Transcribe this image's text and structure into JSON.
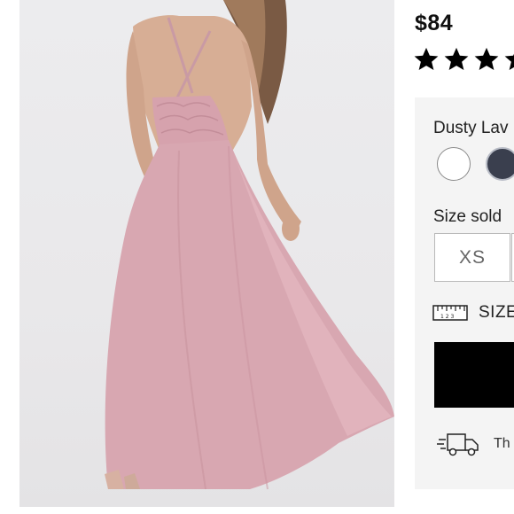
{
  "product": {
    "price": "$84",
    "rating_stars": 5,
    "color_label": "Dusty Lav",
    "swatches": [
      {
        "name": "white",
        "color": "#ffffff"
      },
      {
        "name": "navy",
        "color": "#3a3f4e"
      }
    ],
    "size_label": "Size sold",
    "sizes": [
      "XS"
    ],
    "size_guide_label": "SIZE",
    "shipping_text": "Th"
  },
  "colors": {
    "dress": "#d9a9b3",
    "panel_bg": "#f4f4f4",
    "add_button": "#000000"
  }
}
